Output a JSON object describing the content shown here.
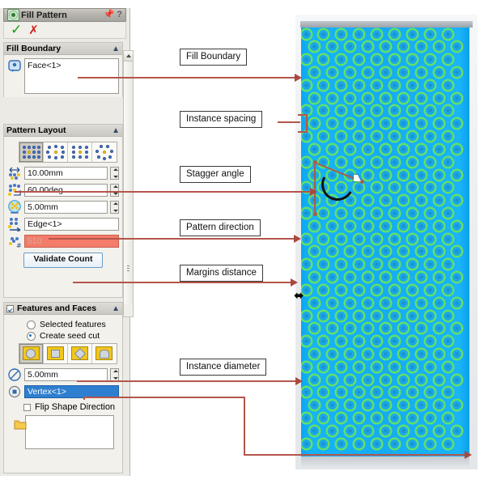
{
  "panel": {
    "title": "Fill Pattern",
    "title_icon": "fill-pattern-icon",
    "pin_icon": "pin-icon",
    "help_icon": "help-icon",
    "accept_icon": "green-check-icon",
    "cancel_icon": "red-x-icon",
    "groups": {
      "fill_boundary": {
        "title": "Fill Boundary",
        "collapse_icon": "chevron-up-icon",
        "select_icon": "face-select-icon",
        "selection_value": "Face<1>"
      },
      "pattern_layout": {
        "title": "Pattern Layout",
        "collapse_icon": "chevron-up-icon",
        "layout_buttons": [
          {
            "name": "perforation-layout",
            "selected": true
          },
          {
            "name": "circular-layout",
            "selected": false
          },
          {
            "name": "square-layout",
            "selected": false
          },
          {
            "name": "polygon-layout",
            "selected": false
          }
        ],
        "spacing_label_icon": "instance-spacing-icon",
        "spacing_value": "10.00mm",
        "stagger_label_icon": "stagger-angle-icon",
        "stagger_value": "60.00deg",
        "margin_label_icon": "margins-icon",
        "margin_value": "5.00mm",
        "direction_label_icon": "pattern-direction-icon",
        "direction_value": "Edge<1>",
        "count_label_icon": "instance-count-icon",
        "count_value": "510",
        "validate_button": "Validate Count"
      },
      "features_and_faces": {
        "title": "Features and Faces",
        "collapse_icon": "chevron-up-icon",
        "enabled": true,
        "radio_selected_features": "Selected features",
        "radio_create_seed_cut": "Create seed cut",
        "selected_radio": "create_seed_cut",
        "shape_buttons": [
          {
            "name": "circle-seed-shape",
            "selected": true
          },
          {
            "name": "square-seed-shape",
            "selected": false
          },
          {
            "name": "diamond-seed-shape",
            "selected": false
          },
          {
            "name": "polygon-seed-shape",
            "selected": false
          }
        ],
        "diameter_label_icon": "diameter-icon",
        "diameter_value": "5.00mm",
        "vertex_label_icon": "vertex-icon",
        "vertex_value": "Vertex<1>",
        "flip_shape_label": "Flip Shape Direction",
        "flip_shape_checked": false,
        "bodies_icon": "bodies-folder-icon",
        "bodies_value": ""
      }
    },
    "scrollbar": {
      "up_arrow_icon": "scroll-up-icon",
      "grip_icon": "scroll-grip-icon"
    }
  },
  "callouts": [
    {
      "id": "fill-boundary",
      "label": "Fill Boundary"
    },
    {
      "id": "instance-spacing",
      "label": "Instance spacing"
    },
    {
      "id": "stagger-angle",
      "label": "Stagger angle"
    },
    {
      "id": "pattern-direction",
      "label": "Pattern direction"
    },
    {
      "id": "margins-distance",
      "label": "Margins distance"
    },
    {
      "id": "instance-diameter",
      "label": "Instance diameter"
    }
  ],
  "model": {
    "name": "perforated-plate",
    "hole_columns": 9,
    "hole_rows": 33,
    "stagger_gizmo_icon": "stagger-angle-gizmo",
    "margin_marker_icon": "double-arrow-icon",
    "colors": {
      "plate": "#17b3f7",
      "hole_ring": "#62e06a",
      "leader": "#b5554b",
      "callout_border": "#3a3a3a"
    }
  }
}
